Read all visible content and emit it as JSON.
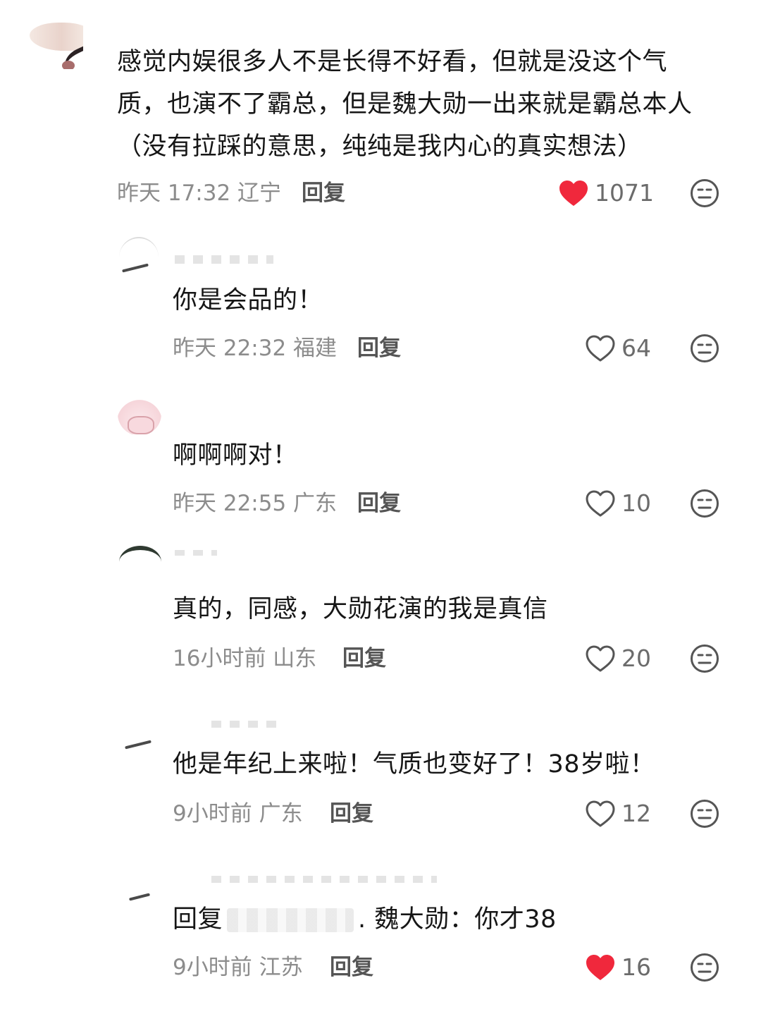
{
  "main_comment": {
    "text_lines": [
      "感觉内娱很多人不是长得不好看，但就是没这个气",
      "质，也演不了霸总，但是魏大勋一出来就是霸总本人",
      "（没有拉踩的意思，纯纯是我内心的真实想法）"
    ],
    "meta": "昨天 17:32 辽宁",
    "reply_label": "回复",
    "likes": "1071",
    "liked": true
  },
  "replies": [
    {
      "text": "你是会品的！",
      "meta": "昨天 22:32 福建",
      "reply_label": "回复",
      "likes": "64",
      "liked": false
    },
    {
      "text": "啊啊啊对！",
      "meta": "昨天 22:55 广东",
      "reply_label": "回复",
      "likes": "10",
      "liked": false
    },
    {
      "text": "真的，同感，大勋花演的我是真信",
      "meta": "16小时前 山东",
      "reply_label": "回复",
      "likes": "20",
      "liked": false
    },
    {
      "text": "他是年纪上来啦！气质也变好了！38岁啦！",
      "meta": "9小时前 广东",
      "reply_label": "回复",
      "likes": "12",
      "liked": false
    },
    {
      "text_prefix": "回复",
      "text_suffix": ". 魏大勋：你才38",
      "meta": "9小时前 江苏",
      "reply_label": "回复",
      "likes": "16",
      "liked": true
    }
  ],
  "colors": {
    "text": "#161616",
    "meta": "#8c8c8c",
    "liked_heart": "#f0283c",
    "outline_heart": "#555555"
  },
  "icons": {
    "like": "heart-icon",
    "dislike": "meh-face-icon"
  }
}
